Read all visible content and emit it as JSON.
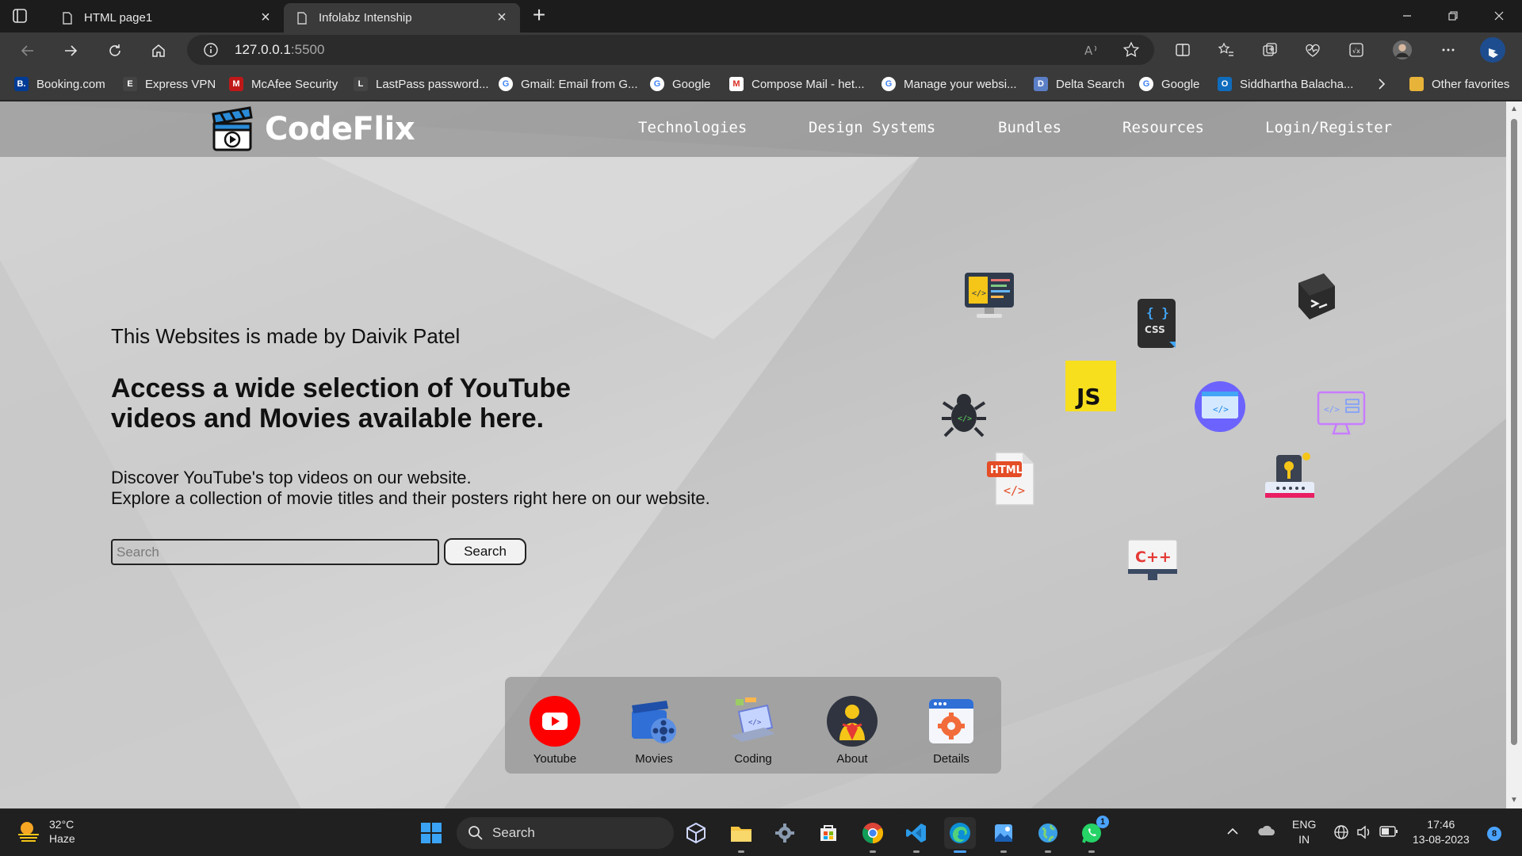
{
  "browser": {
    "tabs": [
      {
        "title": "HTML page1",
        "active": false
      },
      {
        "title": "Infolabz Intenship",
        "active": true
      }
    ],
    "url_host": "127.0.0.1",
    "url_port": ":5500",
    "bookmarks": [
      {
        "label": "Booking.com",
        "icon": "booking-icon",
        "color": "#003b95"
      },
      {
        "label": "Express VPN",
        "icon": "expressvpn-icon",
        "color": "#444444"
      },
      {
        "label": "McAfee Security",
        "icon": "mcafee-icon",
        "color": "#c01818"
      },
      {
        "label": "LastPass password...",
        "icon": "lastpass-icon",
        "color": "#444444"
      },
      {
        "label": "Gmail: Email from G...",
        "icon": "google-icon",
        "color": "#ffffff"
      },
      {
        "label": "Google",
        "icon": "google-icon",
        "color": "#ffffff"
      },
      {
        "label": "Compose Mail - het...",
        "icon": "gmail-icon",
        "color": "#ffffff"
      },
      {
        "label": "Manage your websi...",
        "icon": "google-icon",
        "color": "#ffffff"
      },
      {
        "label": "Delta Search",
        "icon": "delta-search-icon",
        "color": "#5b7fc7"
      },
      {
        "label": "Google",
        "icon": "google-icon",
        "color": "#ffffff"
      },
      {
        "label": "Siddhartha Balacha...",
        "icon": "outlook-icon",
        "color": "#0f6cbd"
      }
    ],
    "other_favorites": "Other favorites"
  },
  "site": {
    "brand": "CodeFlix",
    "nav": [
      "Technologies",
      "Design Systems",
      "Bundles",
      "Resources",
      "Login/Register"
    ],
    "credit": "This Websites is made by Daivik Patel",
    "title": "Access a wide selection of YouTube videos and Movies available here.",
    "desc_line1": "Discover YouTube's top videos on our website.",
    "desc_line2": "Explore a collection of movie titles and their posters right here on our website.",
    "search_placeholder": "Search",
    "search_button": "Search",
    "floating_icons": {
      "css_label": "CSS",
      "js_label": "JS",
      "html_label": "HTML",
      "cpp_label": "C++"
    },
    "dock": [
      {
        "label": "Youtube",
        "icon": "youtube-icon"
      },
      {
        "label": "Movies",
        "icon": "movie-reel-icon"
      },
      {
        "label": "Coding",
        "icon": "coding-laptop-icon"
      },
      {
        "label": "About",
        "icon": "about-icon"
      },
      {
        "label": "Details",
        "icon": "details-gear-icon"
      }
    ]
  },
  "taskbar": {
    "temperature": "32°C",
    "weather": "Haze",
    "search_label": "Search",
    "lang_top": "ENG",
    "lang_bottom": "IN",
    "time": "17:46",
    "date": "13-08-2023",
    "notification_count": "8",
    "whatsapp_badge": "1"
  },
  "colors": {
    "accent": "#4aa3ff",
    "youtube_red": "#ff0000",
    "js_yellow": "#f7df1e"
  }
}
